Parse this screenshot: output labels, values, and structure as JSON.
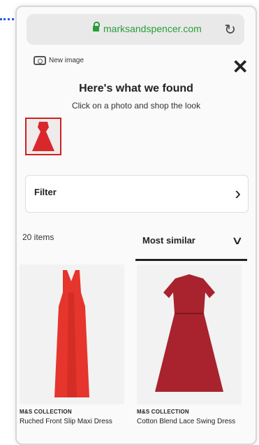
{
  "browser": {
    "url": "marksandspencer.com"
  },
  "header": {
    "new_image_label": "New image",
    "title": "Here's what we found",
    "subtitle": "Click on a photo and shop the look"
  },
  "filter": {
    "label": "Filter"
  },
  "results": {
    "count": "20 items",
    "sort_label": "Most similar",
    "products": [
      {
        "brand": "M&S COLLECTION",
        "name": "Ruched Front Slip Maxi Dress",
        "color": "#e5352c"
      },
      {
        "brand": "M&S COLLECTION",
        "name": "Cotton Blend Lace Swing Dress",
        "color": "#a8232d"
      }
    ]
  },
  "colors": {
    "accent_green": "#2a9d3a",
    "dress_red": "#e5352c",
    "dress_dark_red": "#a8232d"
  }
}
